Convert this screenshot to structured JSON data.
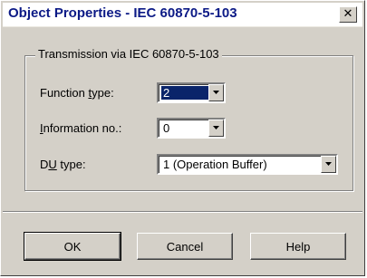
{
  "window": {
    "title": "Object Properties - IEC 60870-5-103",
    "close_glyph": "✕"
  },
  "group": {
    "label": "Transmission via IEC 60870-5-103"
  },
  "fields": {
    "function_type": {
      "label_pre": "Function ",
      "label_accel": "t",
      "label_post": "ype:",
      "value": "2",
      "selected": true
    },
    "information_no": {
      "label_pre": "",
      "label_accel": "I",
      "label_post": "nformation no.:",
      "value": "0"
    },
    "du_type": {
      "label_pre": "D",
      "label_accel": "U",
      "label_post": " type:",
      "value": "1 (Operation Buffer)"
    }
  },
  "buttons": {
    "ok": "OK",
    "cancel": "Cancel",
    "help": "Help"
  },
  "colors": {
    "title_text": "#0c1a86",
    "selection": "#0a246a",
    "face": "#d4d0c8"
  }
}
